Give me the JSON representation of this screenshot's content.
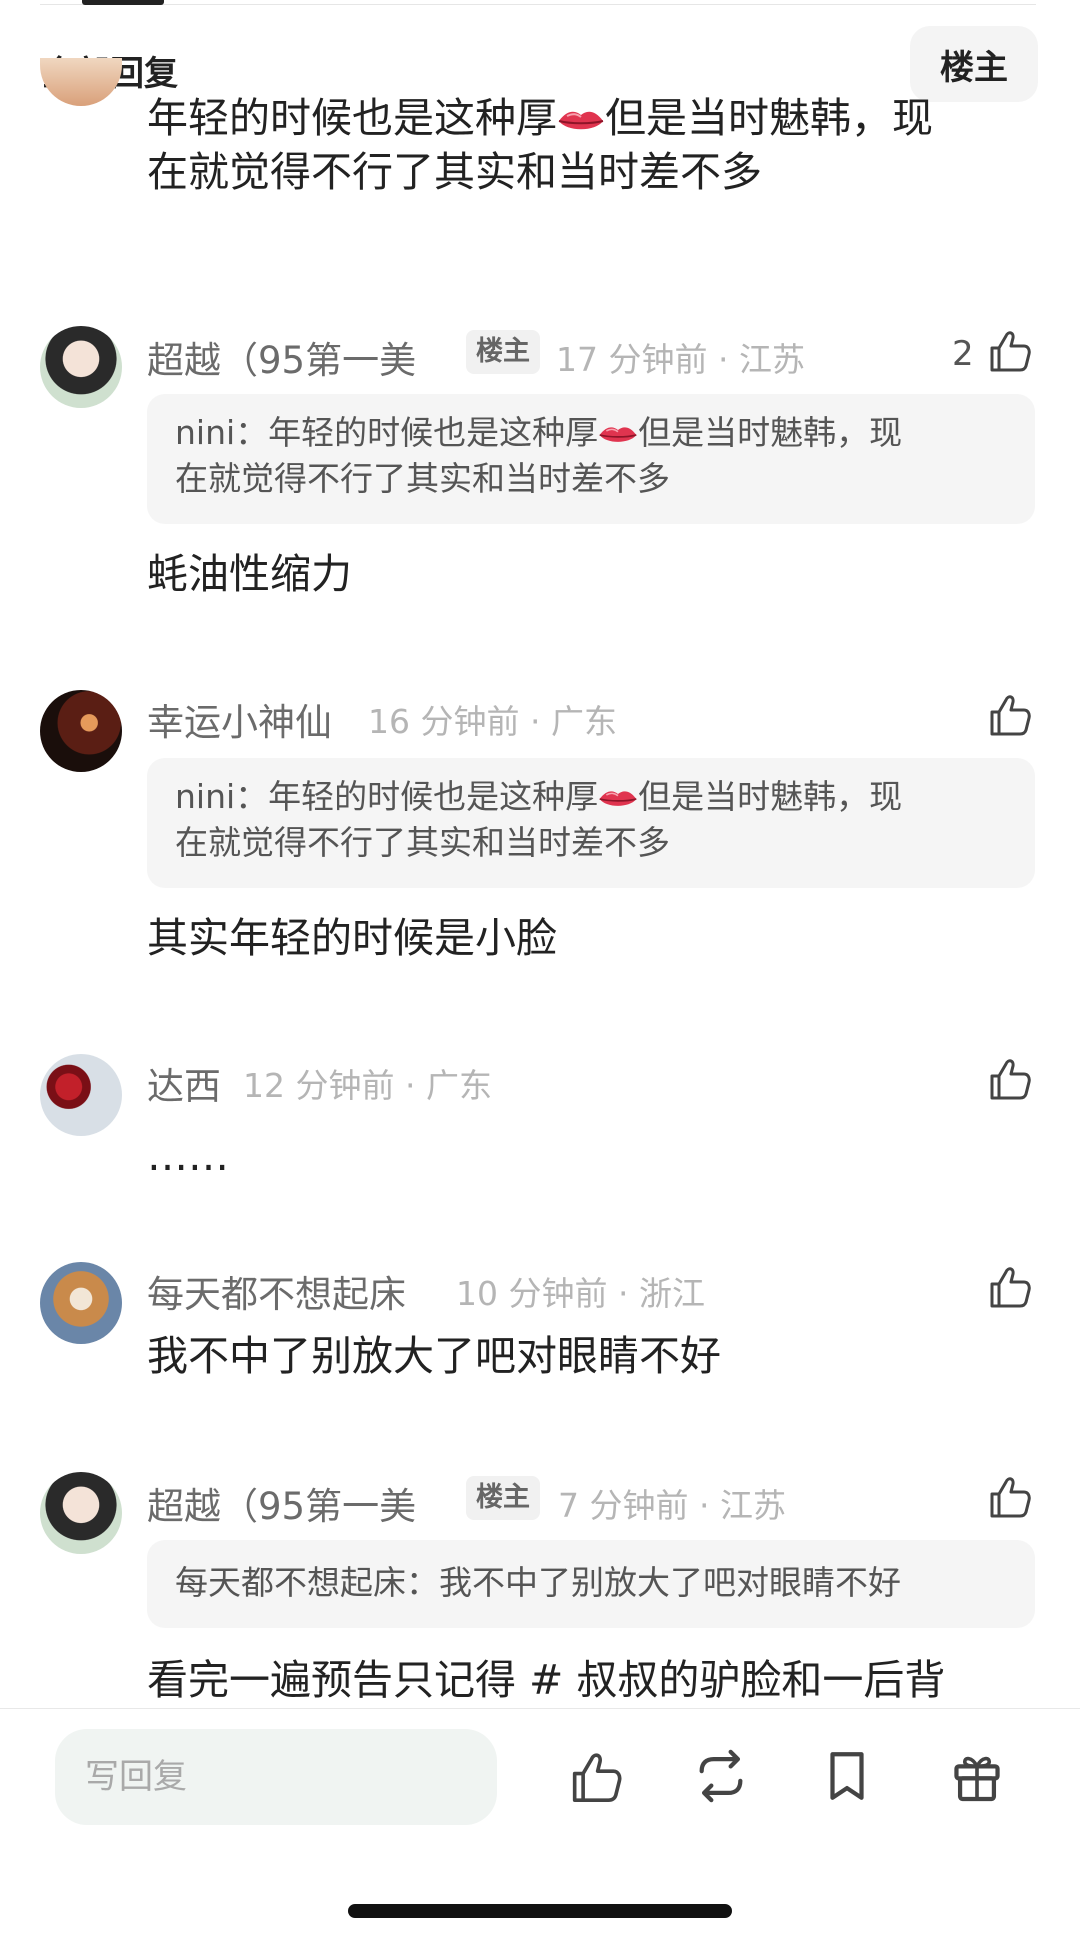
{
  "section": {
    "title": "全部回复",
    "op_filter": "楼主"
  },
  "comments": [
    {
      "text_line1": "年轻的时候也是这种厚",
      "text_line1b": "但是当时魅韩，现",
      "text_line2": "在就觉得不行了其实和当时差不多"
    },
    {
      "username": "超越（95第一美",
      "badge": "楼主",
      "meta": "17 分钟前 · 江苏",
      "likes": "2",
      "quote_prefix": "nini：年轻的时候也是这种厚",
      "quote_suffix": "但是当时魅韩，现",
      "quote_line2": "在就觉得不行了其实和当时差不多",
      "text": "蚝油性缩力"
    },
    {
      "username": "幸运小神仙",
      "meta": "16 分钟前 · 广东",
      "quote_prefix": "nini：年轻的时候也是这种厚",
      "quote_suffix": "但是当时魅韩，现",
      "quote_line2": "在就觉得不行了其实和当时差不多",
      "text": "其实年轻的时候是小脸"
    },
    {
      "username": "达西",
      "meta": "12 分钟前 · 广东",
      "text": "……"
    },
    {
      "username": "每天都不想起床",
      "meta": "10 分钟前 · 浙江",
      "text": "我不中了别放大了吧对眼睛不好"
    },
    {
      "username": "超越（95第一美",
      "badge": "楼主",
      "meta": "7 分钟前 · 江苏",
      "quote": "每天都不想起床：我不中了别放大了吧对眼睛不好",
      "text": "看完一遍预告只记得 # 叔叔的驴脸和一后背"
    }
  ],
  "bottom_bar": {
    "reply_placeholder": "写回复",
    "icons": [
      "thumbs-up-icon",
      "repost-icon",
      "bookmark-icon",
      "gift-icon"
    ]
  },
  "colors": {
    "accent_bg": "#f0f4f2",
    "quote_bg": "#f5f5f5",
    "meta": "#b5b5b5",
    "username": "#6b6b6b"
  }
}
